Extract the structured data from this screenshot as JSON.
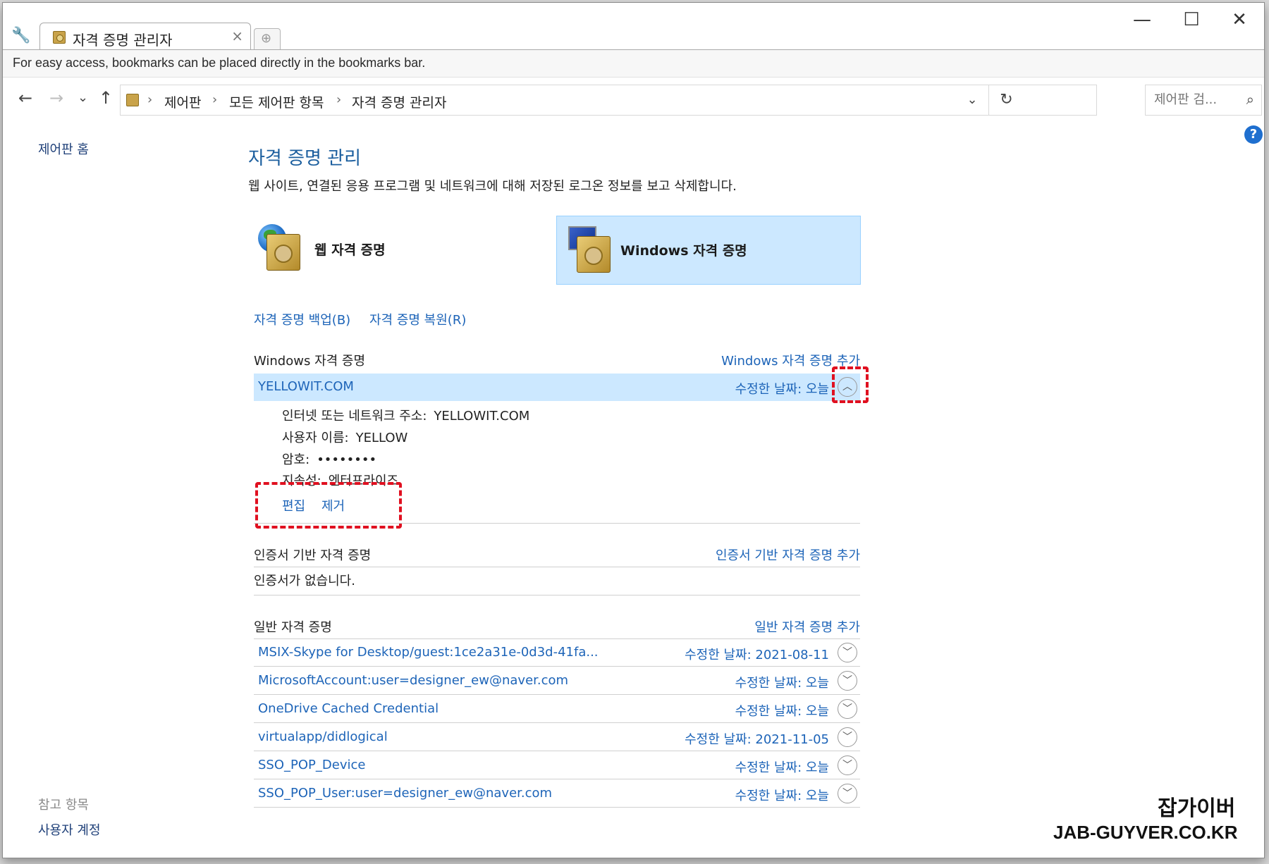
{
  "tab": {
    "title": "자격 증명 관리자",
    "close": "×",
    "new_tab": "⊕"
  },
  "window_controls": {
    "minimize": "—",
    "maximize": "☐",
    "close": "✕"
  },
  "bookmarks_bar": {
    "text": "For easy access, bookmarks can be placed directly in the bookmarks bar."
  },
  "nav": {
    "back": "←",
    "forward": "→",
    "recent": "⌄",
    "up": "↑"
  },
  "address": {
    "crumbs": [
      "제어판",
      "모든 제어판 항목",
      "자격 증명 관리자"
    ],
    "separator": "›",
    "dropdown": "⌄",
    "refresh": "↻"
  },
  "search": {
    "placeholder": "제어판 검...",
    "icon": "⌕"
  },
  "help": {
    "label": "?"
  },
  "sidebar": {
    "home": "제어판 홈",
    "see_also": "참고 항목",
    "user_accounts": "사용자 계정"
  },
  "main": {
    "title": "자격 증명 관리",
    "description": "웹 사이트, 연결된 응용 프로그램 및 네트워크에 대해 저장된 로그온 정보를 보고 삭제합니다.",
    "web_credentials": "웹 자격 증명",
    "windows_credentials": "Windows 자격 증명",
    "backup": "자격 증명 백업(B)",
    "restore": "자격 증명 복원(R)"
  },
  "windows_section": {
    "title": "Windows 자격 증명",
    "add": "Windows 자격 증명 추가",
    "selected": {
      "name": "YELLOWIT.COM",
      "date": "수정한 날짜:  오늘",
      "toggle": "︿",
      "address_label": "인터넷 또는 네트워크 주소:",
      "address_value": "YELLOWIT.COM",
      "user_label": "사용자 이름:",
      "user_value": "YELLOW",
      "password_label": "암호:",
      "password_value": "••••••••",
      "persistence_label": "지속성:",
      "persistence_value": "엔터프라이즈",
      "edit": "편집",
      "remove": "제거"
    }
  },
  "cert_section": {
    "title": "인증서 기반 자격 증명",
    "add": "인증서 기반 자격 증명 추가",
    "empty": "인증서가 없습니다."
  },
  "generic_section": {
    "title": "일반 자격 증명",
    "add": "일반 자격 증명 추가",
    "items": [
      {
        "name": "MSIX-Skype for Desktop/guest:1ce2a31e-0d3d-41fa...",
        "date": "수정한 날짜:  2021-08-11",
        "toggle": "﹀"
      },
      {
        "name": "MicrosoftAccount:user=designer_ew@naver.com",
        "date": "수정한 날짜:  오늘",
        "toggle": "﹀"
      },
      {
        "name": "OneDrive Cached Credential",
        "date": "수정한 날짜:  오늘",
        "toggle": "﹀"
      },
      {
        "name": "virtualapp/didlogical",
        "date": "수정한 날짜:  2021-11-05",
        "toggle": "﹀"
      },
      {
        "name": "SSO_POP_Device",
        "date": "수정한 날짜:  오늘",
        "toggle": "﹀"
      },
      {
        "name": "SSO_POP_User:user=designer_ew@naver.com",
        "date": "수정한 날짜:  오늘",
        "toggle": "﹀"
      }
    ]
  },
  "watermark": {
    "korean": "잡가이버",
    "english": "JAB-GUYVER.CO.KR"
  },
  "colors": {
    "link": "#1d64b8",
    "selection": "#cce8ff",
    "highlight": "#e01020",
    "title": "#1b5e9e"
  },
  "icons": [
    "wrench-icon",
    "credential-vault-icon",
    "globe-icon",
    "monitor-icon",
    "search-icon",
    "help-icon",
    "chevron-up-icon",
    "chevron-down-icon"
  ]
}
